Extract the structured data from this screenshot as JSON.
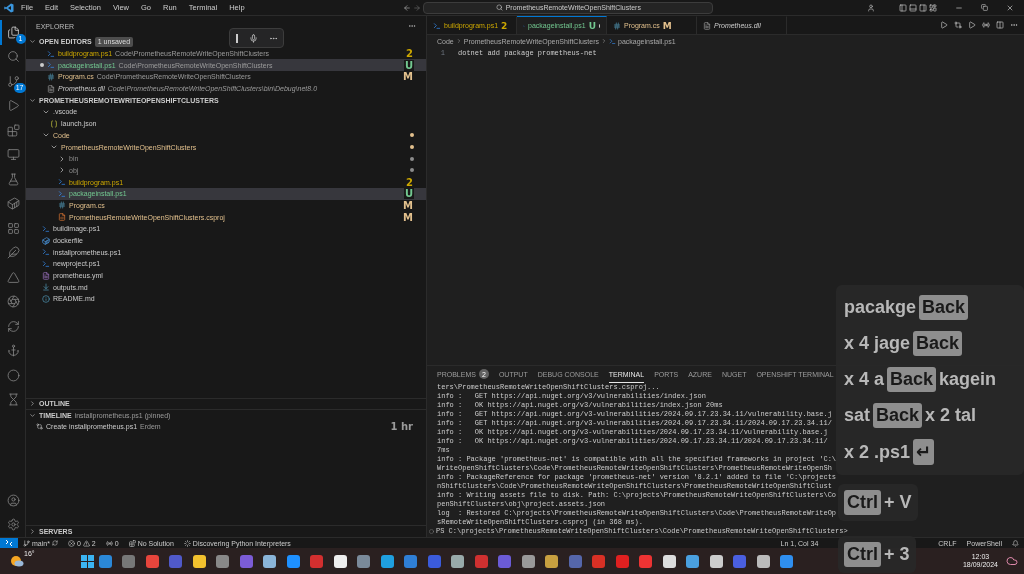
{
  "title_bar": {
    "menu": [
      "File",
      "Edit",
      "Selection",
      "View",
      "Go",
      "Run",
      "Terminal",
      "Help"
    ],
    "search": "PrometheusRemoteWriteOpenShiftClusters"
  },
  "activity_bar": {
    "top": [
      {
        "kind": "files",
        "selected": true,
        "badge": "1"
      },
      {
        "kind": "search",
        "selected": false
      },
      {
        "kind": "source-control",
        "selected": false,
        "badge": "17"
      },
      {
        "kind": "run",
        "selected": false
      },
      {
        "kind": "extensions",
        "selected": false
      },
      {
        "kind": "remote",
        "selected": false
      },
      {
        "kind": "testing",
        "selected": false
      },
      {
        "kind": "docker",
        "selected": false
      },
      {
        "kind": "grid",
        "selected": false
      },
      {
        "kind": "feather",
        "selected": false
      },
      {
        "kind": "azure",
        "selected": false
      },
      {
        "kind": "aperture",
        "selected": false
      },
      {
        "kind": "sync",
        "selected": false
      },
      {
        "kind": "helm",
        "selected": false
      },
      {
        "kind": "circle",
        "selected": false
      },
      {
        "kind": "hourglass",
        "selected": false
      }
    ],
    "bottom": [
      {
        "kind": "account",
        "selected": false
      },
      {
        "kind": "settings",
        "selected": false
      }
    ]
  },
  "sidebar": {
    "title": "EXPLORER",
    "open_editors": {
      "label": "OPEN EDITORS",
      "badge": "1 unsaved",
      "items": [
        {
          "name": "buildprogram.ps1",
          "path": "Code\\PrometheusRemoteWriteOpenShiftClusters",
          "kind": "ps1",
          "color": "#cca700",
          "status": "2",
          "dirty": false,
          "selected": false,
          "preview": false
        },
        {
          "name": "packageinstall.ps1",
          "path": "Code\\PrometheusRemoteWriteOpenShiftClusters",
          "kind": "ps1",
          "color": "#73c991",
          "status": "U",
          "dirty": true,
          "selected": true,
          "preview": false
        },
        {
          "name": "Program.cs",
          "path": "Code\\PrometheusRemoteWriteOpenShiftClusters",
          "kind": "cs",
          "color": "#e2c08d",
          "status": "M",
          "dirty": false,
          "selected": false,
          "preview": false
        },
        {
          "name": "Prometheus.dll",
          "path": "Code\\PrometheusRemoteWriteOpenShiftClusters\\bin\\Debug\\net8.0",
          "kind": "dll",
          "dirty": false,
          "selected": false,
          "preview": true
        }
      ]
    },
    "folder": {
      "label": "PROMETHEUSREMOTEWRITEOPENSHIFTCLUSTERS",
      "expanded": true,
      "children": [
        {
          "name": ".vscode",
          "kind": "folder",
          "expanded": true,
          "selected": false,
          "dot": false,
          "children": [
            {
              "name": "launch.json",
              "kind": "json",
              "selected": false,
              "dot": false
            }
          ]
        },
        {
          "name": "Code",
          "kind": "folder",
          "color": "#e2c08d",
          "expanded": true,
          "selected": false,
          "dot": true,
          "children": [
            {
              "name": "PrometheusRemoteWriteOpenShiftClusters",
              "kind": "folder",
              "color": "#e2c08d",
              "expanded": true,
              "selected": false,
              "dot": true,
              "children": [
                {
                  "name": "bin",
                  "kind": "folder",
                  "color": "#8c8c8c",
                  "expanded": false,
                  "selected": false,
                  "dot": true
                },
                {
                  "name": "obj",
                  "kind": "folder",
                  "color": "#8c8c8c",
                  "expanded": false,
                  "selected": false,
                  "dot": true
                },
                {
                  "name": "buildprogram.ps1",
                  "kind": "ps1",
                  "color": "#cca700",
                  "status": "2",
                  "selected": false,
                  "dot": false
                },
                {
                  "name": "packageinstall.ps1",
                  "kind": "ps1",
                  "color": "#73c991",
                  "status": "U",
                  "selected": true,
                  "dot": false
                },
                {
                  "name": "Program.cs",
                  "kind": "cs",
                  "color": "#e2c08d",
                  "status": "M",
                  "selected": false,
                  "dot": false
                },
                {
                  "name": "PrometheusRemoteWriteOpenShiftClusters.csproj",
                  "kind": "csproj",
                  "color": "#e2c08d",
                  "status": "M",
                  "selected": false,
                  "dot": false
                }
              ]
            }
          ]
        },
        {
          "name": "buildimage.ps1",
          "kind": "ps1",
          "selected": false,
          "dot": false
        },
        {
          "name": "dockerfile",
          "kind": "docker",
          "selected": false,
          "dot": false
        },
        {
          "name": "installprometheus.ps1",
          "kind": "ps1",
          "selected": false,
          "dot": false
        },
        {
          "name": "newproject.ps1",
          "kind": "ps1",
          "selected": false,
          "dot": false
        },
        {
          "name": "prometheus.yml",
          "kind": "yml",
          "selected": false,
          "dot": false
        },
        {
          "name": "outputs.md",
          "kind": "md",
          "selected": false,
          "dot": false
        },
        {
          "name": "README.md",
          "kind": "readme",
          "selected": false,
          "dot": false
        }
      ]
    },
    "outline": {
      "label": "OUTLINE",
      "expanded": false
    },
    "timeline": {
      "label": "TIMELINE",
      "expanded": true,
      "pinned": "installprometheus.ps1 (pinned)",
      "entries": [
        {
          "label": "Create installprometheus.ps1",
          "author": "Erdem",
          "time": "1 hr"
        }
      ]
    },
    "servers": {
      "label": "SERVERS",
      "expanded": false
    }
  },
  "editor": {
    "tabs": [
      {
        "label": "buildprogram.ps1",
        "kind": "ps1",
        "color": "#cca700",
        "status": "2",
        "selected": false,
        "dirty": false,
        "preview": false
      },
      {
        "label": "packageinstall.ps1",
        "kind": "ps1",
        "color": "#73c991",
        "status": "U",
        "selected": true,
        "dirty": true,
        "preview": false
      },
      {
        "label": "Program.cs",
        "kind": "cs",
        "color": "#e2c08d",
        "status": "M",
        "selected": false,
        "dirty": false,
        "preview": false
      },
      {
        "label": "Prometheus.dll",
        "kind": "dll",
        "selected": false,
        "dirty": false,
        "preview": true
      }
    ],
    "breadcrumb": [
      "Code",
      "PrometheusRemoteWriteOpenShiftClusters",
      "packageinstall.ps1"
    ],
    "lines": [
      {
        "number": "1",
        "text": "dotnet add package prometheus-net"
      }
    ]
  },
  "panel": {
    "tabs": [
      {
        "label": "PROBLEMS",
        "badge": "2",
        "selected": false
      },
      {
        "label": "OUTPUT",
        "selected": false
      },
      {
        "label": "DEBUG CONSOLE",
        "selected": false
      },
      {
        "label": "TERMINAL",
        "selected": true
      },
      {
        "label": "PORTS",
        "selected": false
      },
      {
        "label": "AZURE",
        "selected": false
      },
      {
        "label": "NUGET",
        "selected": false
      },
      {
        "label": "OPENSHIFT TERMINAL",
        "selected": false
      }
    ],
    "terminal": [
      "ters\\PrometheusRemoteWriteOpenShiftClusters.csproj...",
      "info :   GET https://api.nuget.org/v3/vulnerabilities/index.json",
      "info :   OK https://api.nuget.org/v3/vulnerabilities/index.json 20ms",
      "info :   GET https://api.nuget.org/v3-vulnerabilities/2024.09.17.23.34.11/vulnerability.base.j",
      "info :   GET https://api.nuget.org/v3-vulnerabilities/2024.09.17.23.34.11/2024.09.17.23.34.11/",
      "info :   OK https://api.nuget.org/v3-vulnerabilities/2024.09.17.23.34.11/vulnerability.base.j",
      "info :   OK https://api.nuget.org/v3-vulnerabilities/2024.09.17.23.34.11/2024.09.17.23.34.11/",
      "7ms",
      "info : Package 'prometheus-net' is compatible with all the specified frameworks in project 'C:\\",
      "WriteOpenShiftClusters\\Code\\PrometheusRemoteWriteOpenShiftClusters\\PrometheusRemoteWriteOpenSh",
      "info : PackageReference for package 'prometheus-net' version '8.2.1' added to file 'C:\\projects",
      "nShiftClusters\\Code\\PrometheusRemoteWriteOpenShiftClusters\\PrometheusRemoteWriteOpenShiftClust",
      "info : Writing assets file to disk. Path: C:\\projects\\PrometheusRemoteWriteOpenShiftClusters\\Co",
      "penShiftClusters\\obj\\project.assets.json",
      "log  : Restored C:\\projects\\PrometheusRemoteWriteOpenShiftClusters\\Code\\PrometheusRemoteWriteOp",
      "sRemoteWriteOpenShiftClusters.csproj (in 368 ms)."
    ],
    "prompt": "PS C:\\projects\\PrometheusRemoteWriteOpenShiftClusters\\Code\\PrometheusRemoteWriteOpenShiftClusters>"
  },
  "status_bar": {
    "branch": "main*",
    "errors": "0",
    "warnings": "2",
    "ports": "0",
    "solution": "No Solution",
    "task": "Discovering Python Interpreters",
    "position": "Ln 1, Col 34",
    "right": [
      "CRLF",
      "PowerShell"
    ]
  },
  "taskbar": {
    "weather": "16°",
    "time": "12:03",
    "date": "18/09/2024"
  },
  "keystrokes": [
    {
      "segments": [
        {
          "kind": "text",
          "text": "pacakge"
        },
        {
          "kind": "key",
          "text": "Back"
        }
      ]
    },
    {
      "segments": [
        {
          "kind": "text",
          "text": "x 4 jage"
        },
        {
          "kind": "key",
          "text": "Back"
        }
      ]
    },
    {
      "segments": [
        {
          "kind": "text",
          "text": "x 4 a"
        },
        {
          "kind": "key",
          "text": "Back"
        },
        {
          "kind": "text",
          "text": "kagein"
        }
      ]
    },
    {
      "segments": [
        {
          "kind": "text",
          "text": "sat"
        },
        {
          "kind": "key",
          "text": "Back"
        },
        {
          "kind": "text",
          "text": "x 2 tal"
        }
      ]
    },
    {
      "segments": [
        {
          "kind": "text",
          "text": "x 2 .ps1"
        },
        {
          "kind": "key",
          "text": "↵"
        }
      ]
    }
  ],
  "shortcuts": [
    {
      "segments": [
        {
          "kind": "key",
          "text": "Ctrl"
        },
        {
          "kind": "text",
          "text": "+ V"
        }
      ]
    },
    {
      "segments": [
        {
          "kind": "key",
          "text": "Ctrl"
        },
        {
          "kind": "text",
          "text": "+ 3"
        }
      ]
    }
  ]
}
